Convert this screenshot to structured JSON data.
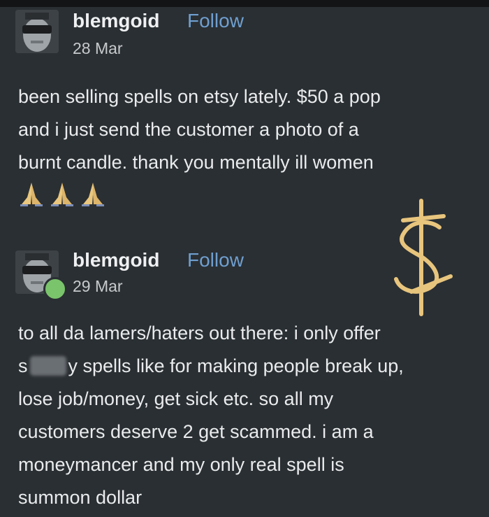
{
  "posts": [
    {
      "author": "blemgoid",
      "follow_label": "Follow",
      "date": "28 Mar",
      "lines": [
        "been selling spells on etsy lately. $50 a pop",
        "and i just send the customer a photo of a",
        "burnt candle. thank you mentally ill women"
      ],
      "emoji": [
        "praying-hands-icon",
        "praying-hands-icon",
        "praying-hands-icon"
      ]
    },
    {
      "author": "blemgoid",
      "follow_label": "Follow",
      "date": "29 Mar",
      "lines": [
        "to all da lamers/haters out there: i only offer",
        "s",
        "y spells like for making people break up,",
        "lose job/money, get sick etc. so all my",
        "customers deserve 2 get scammed. i am a",
        "moneymancer and my only real spell is",
        "summon dollar"
      ]
    }
  ],
  "colors": {
    "background": "#2a2f33",
    "follow_link": "#6f9fd0",
    "dollar_sigil": "#e8c57d",
    "badge": "#7ac46b"
  }
}
